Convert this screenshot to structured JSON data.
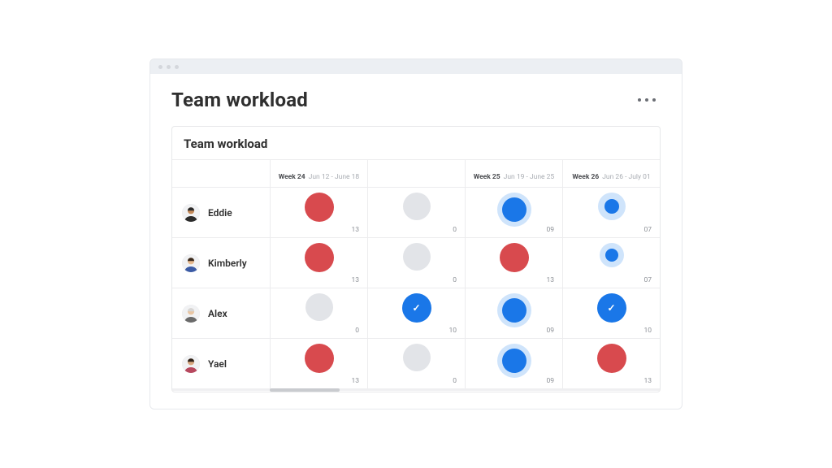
{
  "page": {
    "title": "Team workload",
    "panel_title": "Team workload"
  },
  "columns": [
    {
      "week": "Week 24",
      "range": "Jun 12 - June 18"
    },
    {
      "week": "Week 25",
      "range": "Jun 19 - June 25"
    },
    {
      "week": "Week 26",
      "range": "Jun 26 - July 01"
    }
  ],
  "people": [
    {
      "name": "Eddie"
    },
    {
      "name": "Kimberly"
    },
    {
      "name": "Alex"
    },
    {
      "name": "Yael"
    }
  ],
  "cells": [
    [
      {
        "value": "13",
        "color": "red",
        "core": 36,
        "halo": 0,
        "checked": false
      },
      {
        "value": "0",
        "color": "gray",
        "core": 34,
        "halo": 0,
        "checked": false
      },
      {
        "value": "09",
        "color": "blue",
        "core": 30,
        "halo": 42,
        "checked": false
      },
      {
        "value": "07",
        "color": "blue",
        "core": 18,
        "halo": 34,
        "checked": false
      }
    ],
    [
      {
        "value": "13",
        "color": "red",
        "core": 36,
        "halo": 0,
        "checked": false
      },
      {
        "value": "0",
        "color": "gray",
        "core": 34,
        "halo": 0,
        "checked": false
      },
      {
        "value": "13",
        "color": "red",
        "core": 36,
        "halo": 0,
        "checked": false
      },
      {
        "value": "07",
        "color": "blue",
        "core": 16,
        "halo": 30,
        "checked": false
      }
    ],
    [
      {
        "value": "0",
        "color": "gray",
        "core": 34,
        "halo": 0,
        "checked": false
      },
      {
        "value": "10",
        "color": "blue",
        "core": 36,
        "halo": 0,
        "checked": true
      },
      {
        "value": "09",
        "color": "blue",
        "core": 30,
        "halo": 42,
        "checked": false
      },
      {
        "value": "10",
        "color": "blue",
        "core": 36,
        "halo": 0,
        "checked": true
      }
    ],
    [
      {
        "value": "13",
        "color": "red",
        "core": 36,
        "halo": 0,
        "checked": false
      },
      {
        "value": "0",
        "color": "gray",
        "core": 34,
        "halo": 0,
        "checked": false
      },
      {
        "value": "09",
        "color": "blue",
        "core": 30,
        "halo": 42,
        "checked": false
      },
      {
        "value": "13",
        "color": "red",
        "core": 36,
        "halo": 0,
        "checked": false
      }
    ]
  ],
  "avatar_colors": [
    {
      "skin": "#c48a5a",
      "hair": "#2b2b2b",
      "shirt": "#2b2b2b"
    },
    {
      "skin": "#e6b98f",
      "hair": "#3a2a1d",
      "shirt": "#3b5ba5"
    },
    {
      "skin": "#e9c6a4",
      "hair": "#d6d6d6",
      "shirt": "#6a6a6a"
    },
    {
      "skin": "#d9a880",
      "hair": "#2f231a",
      "shirt": "#b7485e"
    }
  ]
}
